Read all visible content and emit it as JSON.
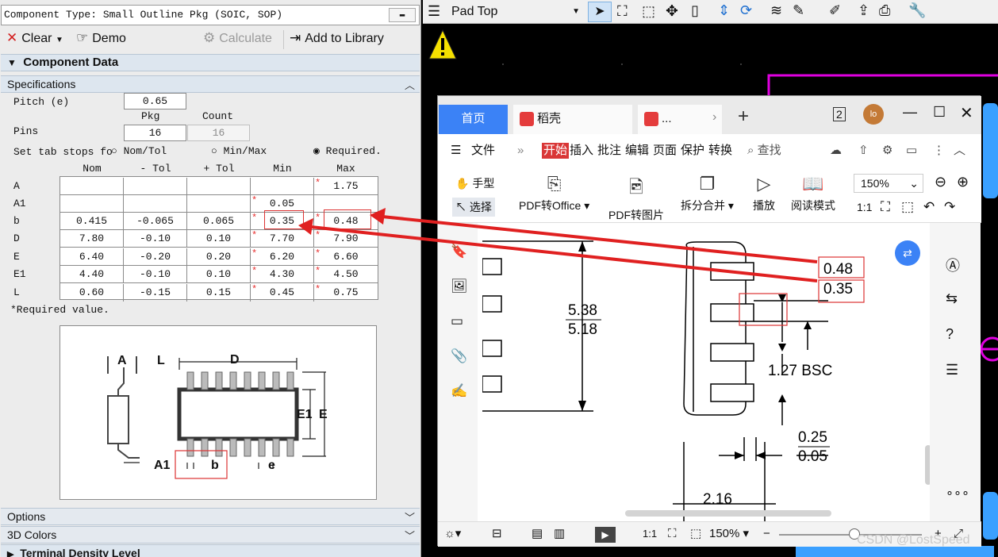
{
  "left_panel": {
    "component_type": "Component Type: Small Outline Pkg (SOIC, SOP)",
    "toolbar": {
      "clear": "Clear",
      "demo": "Demo",
      "calculate": "Calculate",
      "add_to_library": "Add to Library"
    },
    "section_component_data": "Component Data",
    "section_specifications": "Specifications",
    "pitch_label": "Pitch (e)",
    "pitch_value": "0.65",
    "pkg_header": "Pkg",
    "count_header": "Count",
    "pins_label": "Pins",
    "pins_pkg": "16",
    "pins_count": "16",
    "tab_stops_label": "Set tab stops fo",
    "radio_nom_tol": "Nom/Tol",
    "radio_min_max": "Min/Max",
    "radio_required": "Required.",
    "columns": [
      "Nom",
      "- Tol",
      "+ Tol",
      "Min",
      "Max"
    ],
    "rows": [
      {
        "label": "A",
        "nom": "",
        "mtol": "",
        "ptol": "",
        "min": "",
        "max": "1.75",
        "req_max": true
      },
      {
        "label": "A1",
        "nom": "",
        "mtol": "",
        "ptol": "",
        "min": "0.05",
        "max": "",
        "req_min": true
      },
      {
        "label": "b",
        "nom": "0.415",
        "mtol": "-0.065",
        "ptol": "0.065",
        "min": "0.35",
        "max": "0.48",
        "req_min": true,
        "req_max": true
      },
      {
        "label": "D",
        "nom": "7.80",
        "mtol": "-0.10",
        "ptol": "0.10",
        "min": "7.70",
        "max": "7.90",
        "req_min": true,
        "req_max": true
      },
      {
        "label": "E",
        "nom": "6.40",
        "mtol": "-0.20",
        "ptol": "0.20",
        "min": "6.20",
        "max": "6.60",
        "req_min": true,
        "req_max": true
      },
      {
        "label": "E1",
        "nom": "4.40",
        "mtol": "-0.10",
        "ptol": "0.10",
        "min": "4.30",
        "max": "4.50",
        "req_min": true,
        "req_max": true
      },
      {
        "label": "L",
        "nom": "0.60",
        "mtol": "-0.15",
        "ptol": "0.15",
        "min": "0.45",
        "max": "0.75",
        "req_min": true,
        "req_max": true
      }
    ],
    "required_note": "*Required value.",
    "diagram_labels": {
      "A": "A",
      "L": "L",
      "D": "D",
      "E1": "E1",
      "E": "E",
      "A1": "A1",
      "b": "b",
      "e": "e"
    },
    "section_options": "Options",
    "section_3d_colors": "3D Colors",
    "section_terminal_density": "Terminal Density Level"
  },
  "top_toolbar": {
    "layer_select": "Pad Top"
  },
  "pdf_viewer": {
    "tab_home": "首页",
    "tab_docer": "稻壳",
    "tab_doc": "...",
    "tab_badge": "2",
    "avatar": "lo",
    "menu": [
      "文件",
      "开始",
      "插入",
      "批注",
      "编辑",
      "页面",
      "保护",
      "转换"
    ],
    "menu_active": "开始",
    "search": "查找",
    "tools": {
      "hand": "手型",
      "select": "选择",
      "pdf_to_office": "PDF转Office",
      "pdf_to_image": "PDF转图片",
      "split_merge": "拆分合并",
      "play": "播放",
      "read_mode": "阅读模式",
      "zoom": "150%"
    },
    "doc_dims": {
      "d538": "5.38",
      "d518": "5.18",
      "d048": "0.48",
      "d035": "0.35",
      "bsc": "1.27 BSC",
      "d025": "0.25",
      "d005": "0.05",
      "d216": "2.16"
    },
    "status_zoom": "150%"
  },
  "watermark": "CSDN @LostSpeed",
  "colors": {
    "accent_blue": "#3b82f6",
    "annotation_red": "#e02020",
    "pcb_magenta": "#e000e0",
    "pcb_blue": "#3aa0ff",
    "warning_yellow": "#f5e000"
  }
}
